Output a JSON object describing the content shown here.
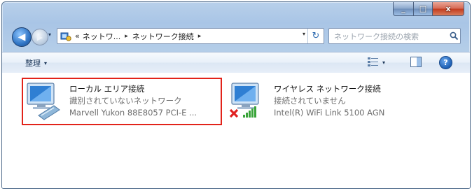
{
  "window": {
    "caption_buttons": {
      "minimize_glyph": "_",
      "maximize_glyph": "□",
      "close_glyph": "x"
    }
  },
  "nav": {
    "back_glyph": "◀",
    "forward_glyph": "▶",
    "dropdown_glyph": "▾"
  },
  "address": {
    "overflow": "«",
    "crumbs": [
      "ネットワ...",
      "ネットワーク接続"
    ],
    "separator": "▸",
    "dropdown_glyph": "▾",
    "refresh_glyph": "↻"
  },
  "search": {
    "placeholder": "ネットワーク接続の検索"
  },
  "toolbar": {
    "organize_label": "整理",
    "dropdown_glyph": "▾"
  },
  "connections": [
    {
      "name": "ローカル エリア接続",
      "status": "識別されていないネットワーク",
      "device": "Marvell Yukon 88E8057 PCI-E ..."
    },
    {
      "name": "ワイヤレス ネットワーク接続",
      "status": "接続されていません",
      "device": "Intel(R) WiFi Link 5100 AGN"
    }
  ],
  "colors": {
    "selection_frame": "#e2231a",
    "disconnected_x": "#e02020",
    "signal_green": "#3aa43a"
  }
}
